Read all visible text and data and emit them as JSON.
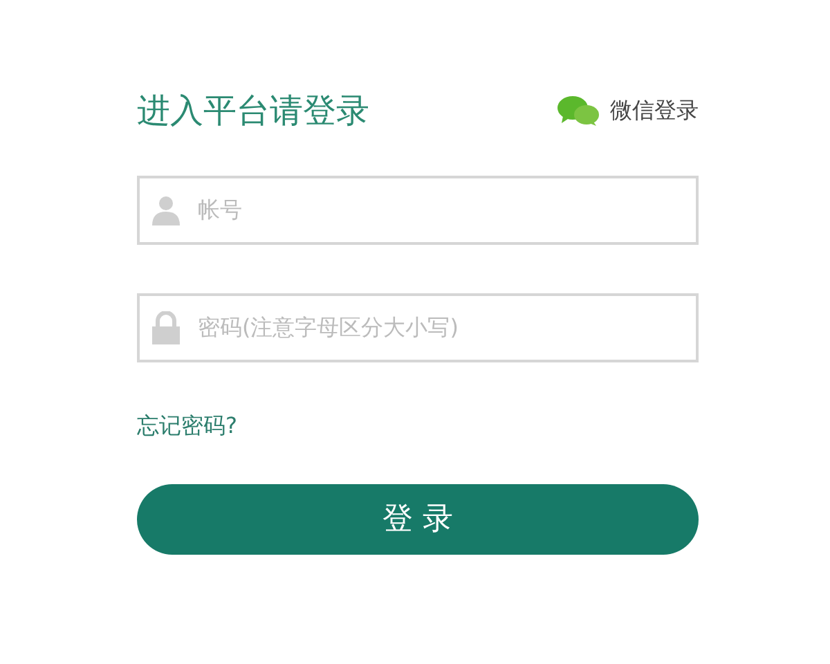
{
  "title": "进入平台请登录",
  "wechat_login": {
    "label": "微信登录"
  },
  "fields": [
    {
      "kind": "user",
      "placeholder": "帐号"
    },
    {
      "kind": "password",
      "placeholder": "密码(注意字母区分大小写)"
    }
  ],
  "forgot_link": "忘记密码?",
  "submit_button": "登 录"
}
